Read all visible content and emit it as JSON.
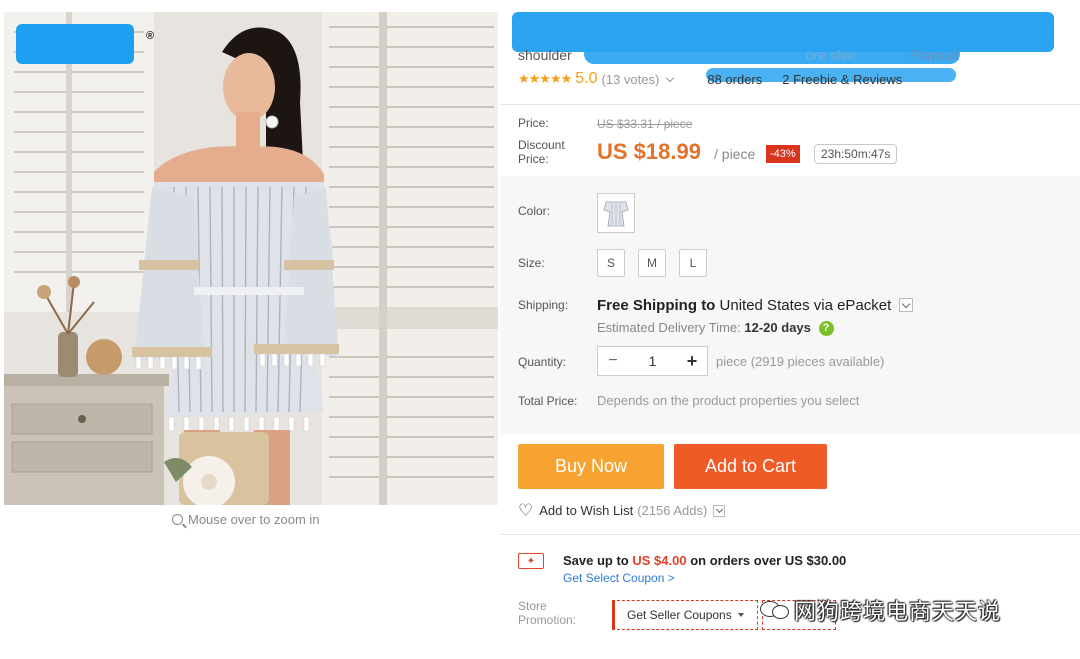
{
  "gallery": {
    "zoom_hint": "Mouse over to zoom in",
    "reg_mark": "®"
  },
  "product": {
    "title_line2_visible": "shoulder",
    "title_line2_tail": "ore slee",
    "title_line2_end": "Playsuit"
  },
  "rating": {
    "stars": "★★★★★",
    "score": "5.0",
    "votes": "(13 votes)",
    "orders": "88 orders",
    "reviews": "2 Freebie & Reviews"
  },
  "price": {
    "price_label": "Price:",
    "old_price": "US $33.31 / piece",
    "discount_label_1": "Discount",
    "discount_label_2": "Price:",
    "new_price": "US $18.99",
    "per_piece": "/ piece",
    "discount_badge": "-43%",
    "timer": "23h:50m:47s"
  },
  "options": {
    "color_label": "Color:",
    "size_label": "Size:",
    "sizes": [
      "S",
      "M",
      "L"
    ],
    "shipping_label": "Shipping:",
    "shipping_free": "Free Shipping",
    "shipping_to": "to",
    "shipping_dest": "United States via ePacket",
    "delivery_label": "Estimated Delivery Time:",
    "delivery_value": "12-20 days",
    "help_icon_glyph": "?",
    "quantity_label": "Quantity:",
    "qty_minus": "−",
    "quantity_value": "1",
    "qty_plus": "+",
    "qty_note": "piece (2919 pieces available)",
    "total_label": "Total Price:",
    "total_note": "Depends on the product properties you select"
  },
  "actions": {
    "buy_now": "Buy Now",
    "add_to_cart": "Add to Cart",
    "wish_label": "Add to Wish List",
    "wish_count": "(2156 Adds)"
  },
  "promo": {
    "save_prefix": "Save up to",
    "save_amount": "US $4.00",
    "save_suffix": "on orders over US $30.00",
    "select_coupon": "Get Select Coupon >",
    "store_label_1": "Store",
    "store_label_2": "Promotion:",
    "seller_coupons": "Get Seller Coupons"
  },
  "watermark": {
    "text": "网狗跨境电商天天说"
  },
  "colors": {
    "accent_orange": "#f6a331",
    "cart_orange": "#f05a27",
    "price_orange": "#e4722a",
    "discount_red": "#d9351c",
    "star_color": "#f59e1a",
    "link_blue": "#2f7ad8",
    "redaction_blue": "#1ea0f2"
  },
  "icons": {
    "zoom": "magnifier-icon",
    "wish": "heart-icon",
    "coupon": "coupon-icon",
    "help": "question-icon",
    "watermark": "wechat-icon"
  }
}
